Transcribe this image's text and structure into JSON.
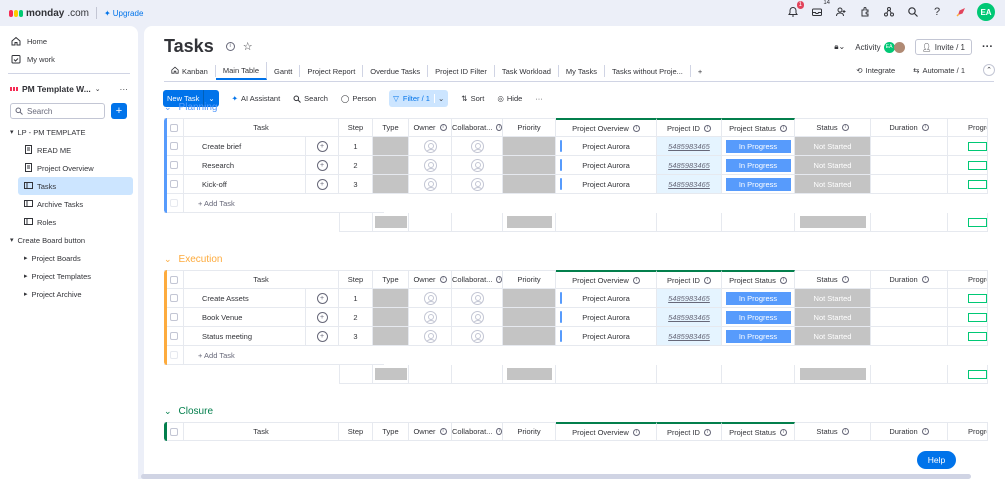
{
  "topbar": {
    "brand": "monday",
    "brand_suffix": ".com",
    "upgrade": "Upgrade",
    "notif_count": "1",
    "inbox_count": "14",
    "avatar": "EA",
    "icons": [
      "bell-icon",
      "inbox-icon",
      "invite-members-icon",
      "apps-icon",
      "integrations-icon",
      "search-icon",
      "help-icon",
      "rocket-icon"
    ]
  },
  "sidebar": {
    "home": "Home",
    "mywork": "My work",
    "workspace": "PM Template W...",
    "search_placeholder": "Search",
    "tree": [
      {
        "label": "LP - PM TEMPLATE",
        "level": 0,
        "type": "folder"
      },
      {
        "label": "READ ME",
        "level": 1,
        "type": "doc"
      },
      {
        "label": "Project Overview",
        "level": 1,
        "type": "doc"
      },
      {
        "label": "Tasks",
        "level": 1,
        "type": "board",
        "active": true
      },
      {
        "label": "Archive Tasks",
        "level": 1,
        "type": "board"
      },
      {
        "label": "Roles",
        "level": 1,
        "type": "board"
      },
      {
        "label": "Create Board button",
        "level": 0,
        "type": "folder"
      },
      {
        "label": "Project Boards",
        "level": 1,
        "type": "subfolder"
      },
      {
        "label": "Project Templates",
        "level": 1,
        "type": "subfolder"
      },
      {
        "label": "Project Archive",
        "level": 1,
        "type": "subfolder"
      }
    ]
  },
  "board": {
    "title": "Tasks",
    "activity": "Activity",
    "invite": "Invite / 1",
    "tabs": [
      "Kanban",
      "Main Table",
      "Gantt",
      "Project Report",
      "Overdue Tasks",
      "Project ID Filter",
      "Task Workload",
      "My Tasks",
      "Tasks without Proje...",
      "+"
    ],
    "active_tab": "Main Table",
    "integrate": "Integrate",
    "automate": "Automate / 1"
  },
  "toolbar": {
    "new_task": "New Task",
    "ai": "AI Assistant",
    "search": "Search",
    "person": "Person",
    "filter": "Filter / 1",
    "sort": "Sort",
    "hide": "Hide",
    "more": "···"
  },
  "columns": [
    "Task",
    "Step",
    "Type",
    "Owner",
    "Collaborat...",
    "Priority",
    "Project Overview",
    "Project ID",
    "Project Status",
    "Status",
    "Duration",
    "Progre"
  ],
  "add_task": "+ Add Task",
  "groups": [
    {
      "name": "Planning",
      "color": "#579bfc",
      "rows": [
        {
          "task": "Create brief",
          "step": "1",
          "overview": "Project Aurora",
          "pid": "5485983465",
          "pstatus": "In Progress",
          "status": "Not Started"
        },
        {
          "task": "Research",
          "step": "2",
          "overview": "Project Aurora",
          "pid": "5485983465",
          "pstatus": "In Progress",
          "status": "Not Started"
        },
        {
          "task": "Kick-off",
          "step": "3",
          "overview": "Project Aurora",
          "pid": "5485983465",
          "pstatus": "In Progress",
          "status": "Not Started"
        }
      ]
    },
    {
      "name": "Execution",
      "color": "#fdab3d",
      "rows": [
        {
          "task": "Create Assets",
          "step": "1",
          "overview": "Project Aurora",
          "pid": "5485983465",
          "pstatus": "In Progress",
          "status": "Not Started"
        },
        {
          "task": "Book Venue",
          "step": "2",
          "overview": "Project Aurora",
          "pid": "5485983465",
          "pstatus": "In Progress",
          "status": "Not Started"
        },
        {
          "task": "Status meeting",
          "step": "3",
          "overview": "Project Aurora",
          "pid": "5485983465",
          "pstatus": "In Progress",
          "status": "Not Started"
        }
      ]
    },
    {
      "name": "Closure",
      "color": "#037f4c",
      "rows": []
    }
  ],
  "help": "Help"
}
